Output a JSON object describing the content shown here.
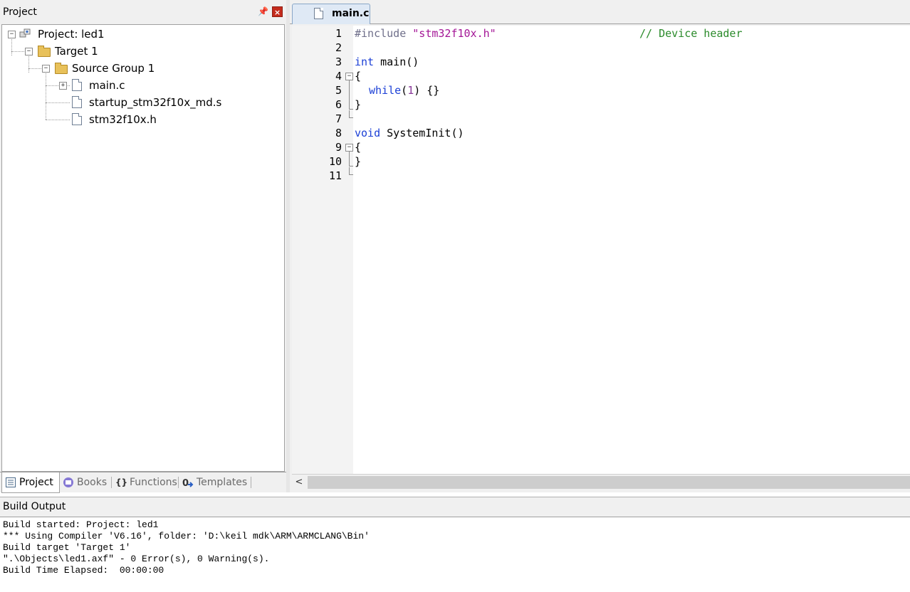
{
  "project_panel": {
    "title": "Project",
    "pin_glyph": "📌",
    "close_glyph": "×",
    "tree": {
      "root": "Project: led1",
      "target": "Target 1",
      "group": "Source Group 1",
      "files": [
        "main.c",
        "startup_stm32f10x_md.s",
        "stm32f10x.h"
      ]
    },
    "tabs": [
      {
        "label": "Project",
        "icon": "project-icon"
      },
      {
        "label": "Books",
        "icon": "books-icon"
      },
      {
        "label": "Functions",
        "icon": "functions-icon"
      },
      {
        "label": "Templates",
        "icon": "templates-icon"
      }
    ]
  },
  "editor": {
    "tab_label": "main.c",
    "line_numbers": [
      "1",
      "2",
      "3",
      "4",
      "5",
      "6",
      "7",
      "8",
      "9",
      "10",
      "11"
    ],
    "code": {
      "l1_pre": "#include ",
      "l1_str": "\"stm32f10x.h\"",
      "l1_cmt": "// Device header",
      "l3_kw": "int",
      "l3_rest": " main()",
      "l4": "{",
      "l5_kw": "while",
      "l5_open": "(",
      "l5_num": "1",
      "l5_rest": ") {}",
      "l6": "}",
      "l8_kw": "void",
      "l8_rest": " SystemInit()",
      "l9": "{",
      "l10": "}"
    },
    "scroll_left_glyph": "<"
  },
  "build_output": {
    "title": "Build Output",
    "lines": [
      "Build started: Project: led1",
      "*** Using Compiler 'V6.16', folder: 'D:\\keil mdk\\ARM\\ARMCLANG\\Bin'",
      "Build target 'Target 1'",
      "\".\\Objects\\led1.axf\" - 0 Error(s), 0 Warning(s).",
      "Build Time Elapsed:  00:00:00"
    ]
  }
}
